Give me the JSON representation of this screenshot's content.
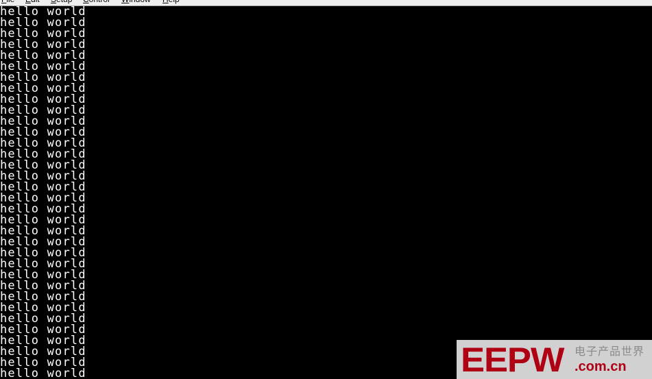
{
  "menubar": {
    "items": [
      {
        "label": "File",
        "accel": "F",
        "rest": "ile"
      },
      {
        "label": "Edit",
        "accel": "E",
        "rest": "dit"
      },
      {
        "label": "Setup",
        "accel": "S",
        "rest": "etup"
      },
      {
        "label": "Control",
        "accel": "C",
        "rest": "ontrol"
      },
      {
        "label": "Window",
        "accel": "W",
        "rest": "indow"
      },
      {
        "label": "Help",
        "accel": "H",
        "rest": "elp"
      }
    ]
  },
  "terminal": {
    "background": "#000000",
    "foreground": "#ffffff",
    "lines": [
      "hello world",
      "hello world",
      "hello world",
      "hello world",
      "hello world",
      "hello world",
      "hello world",
      "hello world",
      "hello world",
      "hello world",
      "hello world",
      "hello world",
      "hello world",
      "hello world",
      "hello world",
      "hello world",
      "hello world",
      "hello world",
      "hello world",
      "hello world",
      "hello world",
      "hello world",
      "hello world",
      "hello world",
      "hello world",
      "hello world",
      "hello world",
      "hello world",
      "hello world",
      "hello world",
      "hello world",
      "hello world",
      "hello world",
      "hello world"
    ]
  },
  "watermark": {
    "logo": "EEPW",
    "chinese": "电子产品世界",
    "url": ".com.cn",
    "color": "#b00014"
  }
}
